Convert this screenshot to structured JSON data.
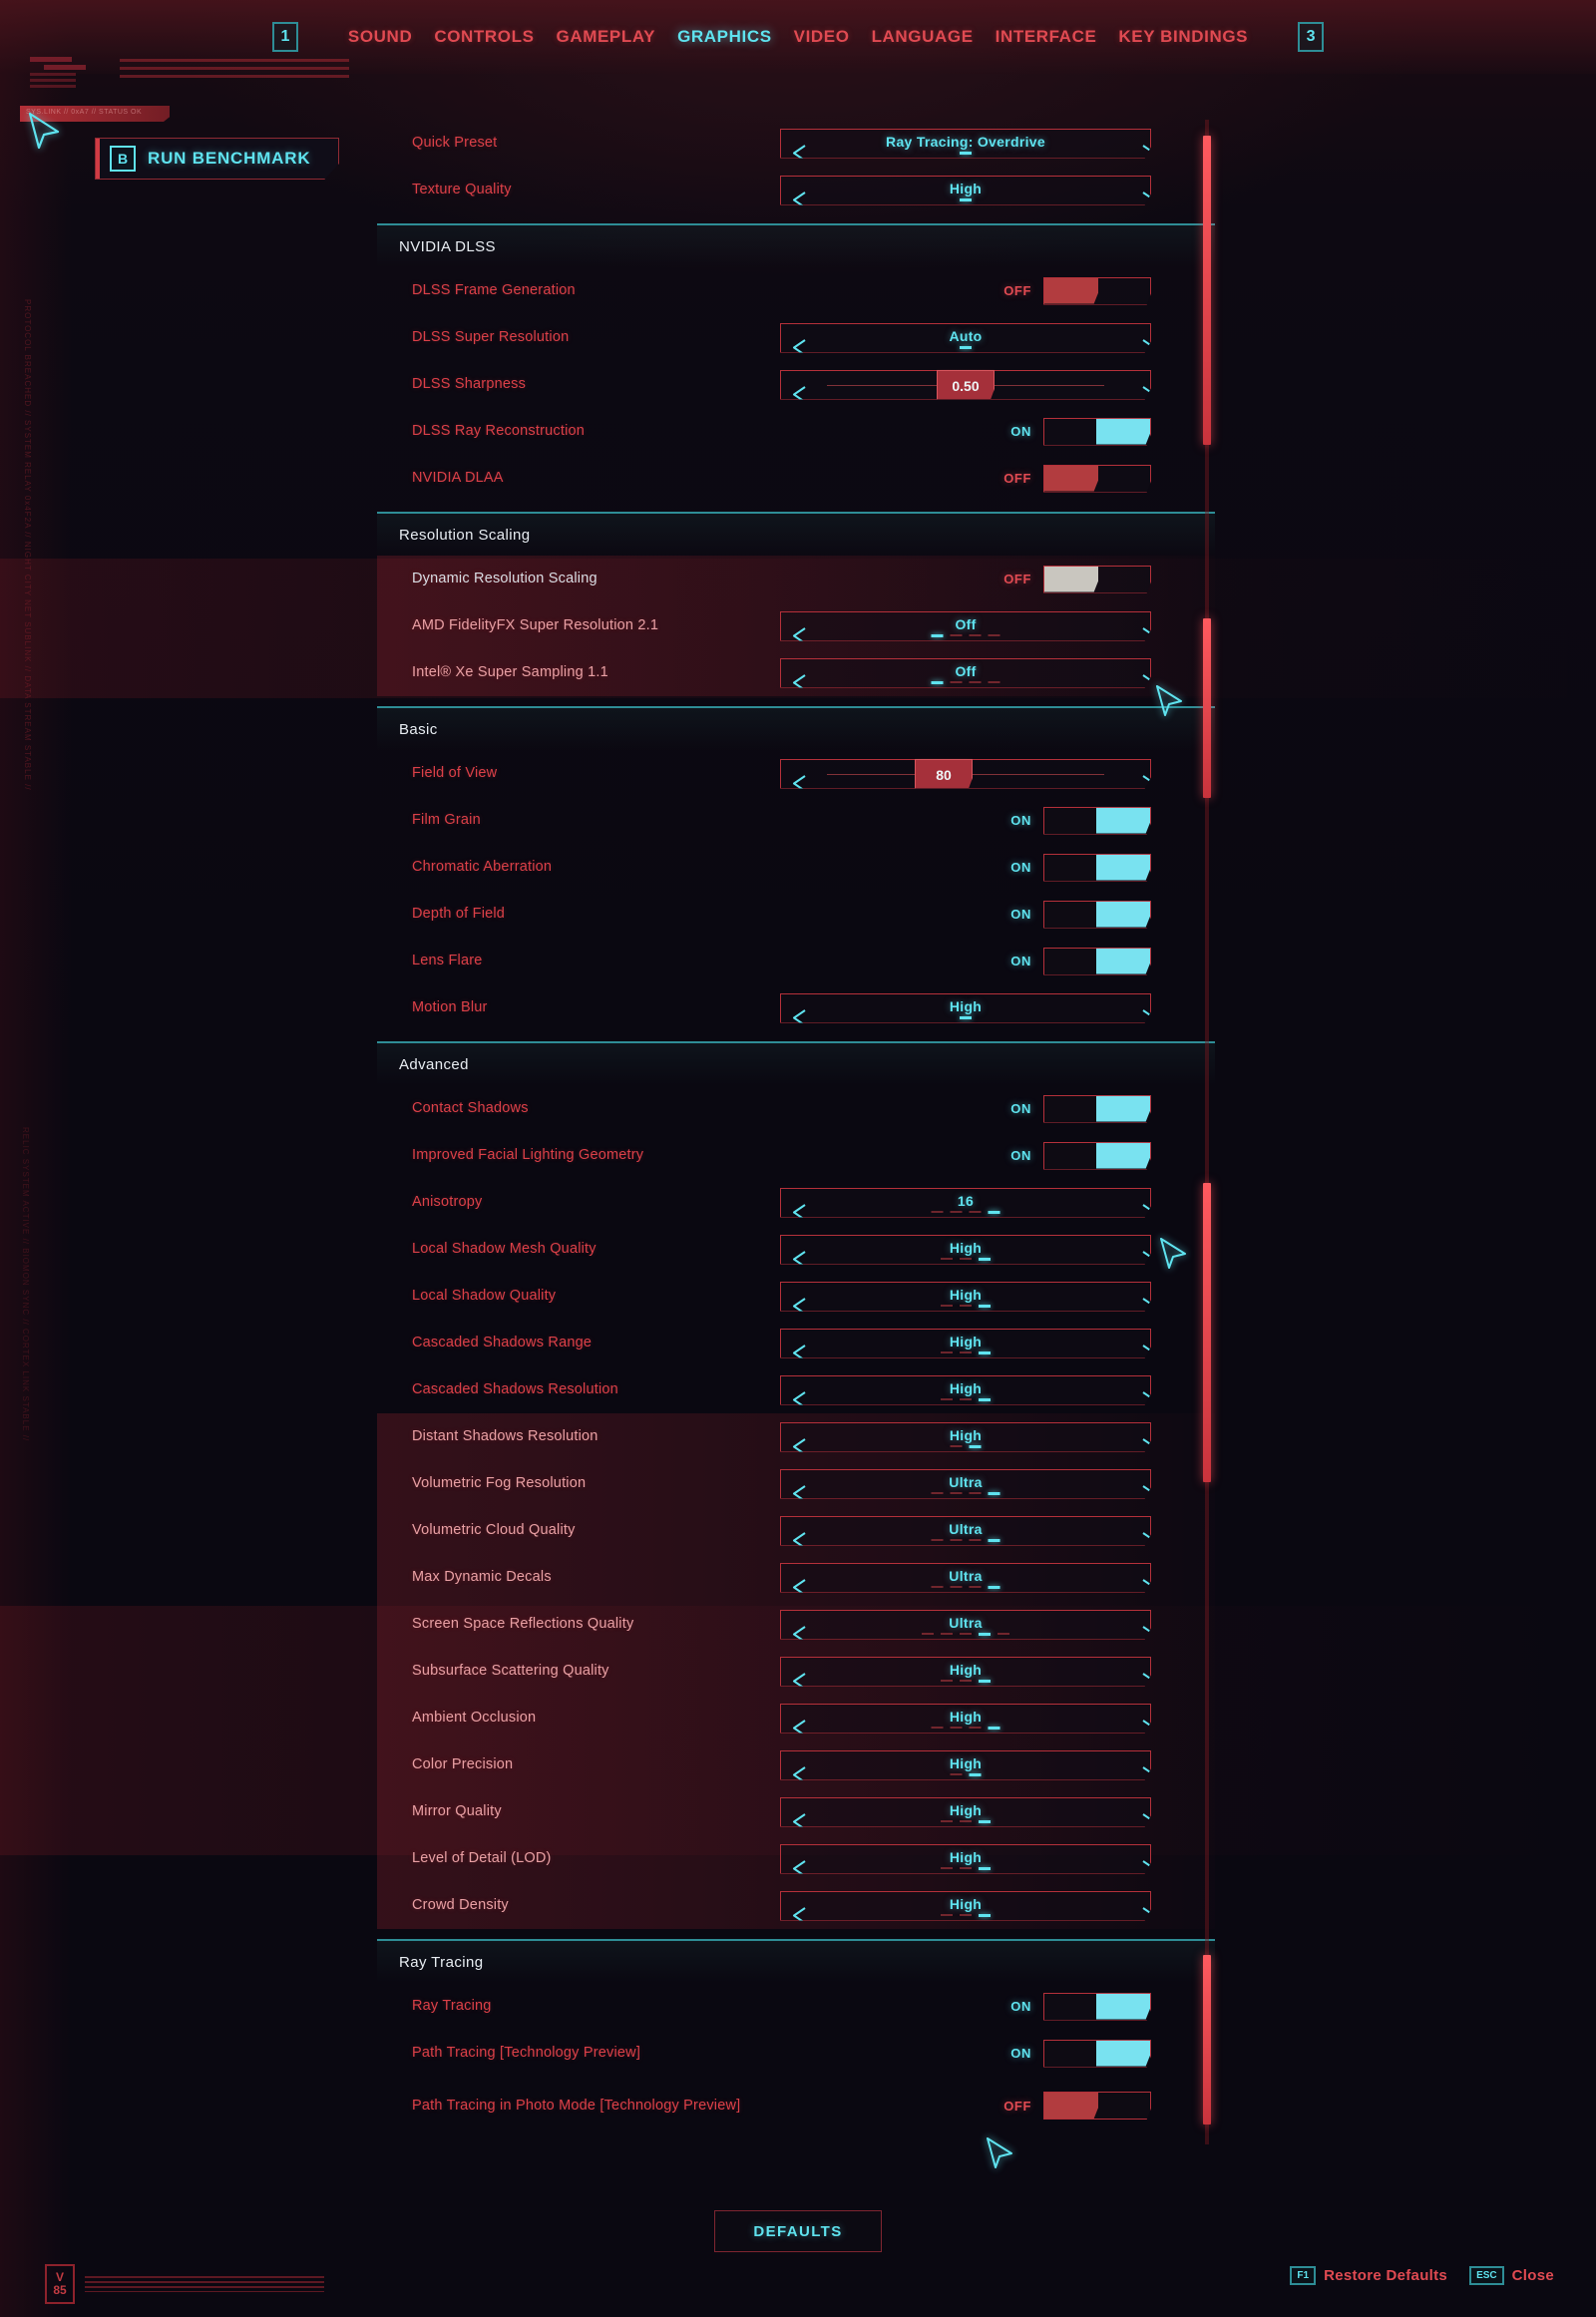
{
  "nav": {
    "left_page": "1",
    "right_page": "3",
    "items": [
      {
        "label": "SOUND",
        "active": false
      },
      {
        "label": "CONTROLS",
        "active": false
      },
      {
        "label": "GAMEPLAY",
        "active": false
      },
      {
        "label": "GRAPHICS",
        "active": true
      },
      {
        "label": "VIDEO",
        "active": false
      },
      {
        "label": "LANGUAGE",
        "active": false
      },
      {
        "label": "INTERFACE",
        "active": false
      },
      {
        "label": "KEY BINDINGS",
        "active": false
      }
    ]
  },
  "benchmark": {
    "key": "B",
    "label": "RUN BENCHMARK"
  },
  "decor": {
    "left_vertical_text": "PROTOCOL BREACHED // SYSTEM RELAY 0x4F2A // NIGHT CITY NET SUBLINK // DATA STREAM STABLE //",
    "left_vertical_text2": "RELIC SYSTEM ACTIVE // BIOMON SYNC // CORTEX LINK STABLE //",
    "red_bar_text": "SYS.LINK // 0xA7 // STATUS OK",
    "version_badge_top": "V",
    "version_badge_bottom": "85"
  },
  "settings": {
    "top_rows": [
      {
        "name": "quick-preset",
        "label": "Quick Preset",
        "type": "select",
        "value": "Ray Tracing: Overdrive",
        "tick_count": 1,
        "tick_active": 0,
        "highlight": false
      },
      {
        "name": "texture-quality",
        "label": "Texture Quality",
        "type": "select",
        "value": "High",
        "tick_count": 1,
        "tick_active": 0,
        "highlight": false
      }
    ],
    "sections": [
      {
        "title": "NVIDIA DLSS",
        "rows": [
          {
            "name": "dlss-frame-generation",
            "label": "DLSS Frame Generation",
            "type": "toggle",
            "state": "OFF",
            "highlight": false
          },
          {
            "name": "dlss-super-resolution",
            "label": "DLSS Super Resolution",
            "type": "select",
            "value": "Auto",
            "tick_count": 1,
            "tick_active": 0,
            "highlight": false
          },
          {
            "name": "dlss-sharpness",
            "label": "DLSS Sharpness",
            "type": "slider",
            "value": "0.50",
            "percent": 50,
            "highlight": false
          },
          {
            "name": "dlss-ray-reconstruction",
            "label": "DLSS Ray Reconstruction",
            "type": "toggle",
            "state": "ON",
            "highlight": false
          },
          {
            "name": "nvidia-dlaa",
            "label": "NVIDIA DLAA",
            "type": "toggle",
            "state": "OFF",
            "highlight": false
          }
        ]
      },
      {
        "title": "Resolution Scaling",
        "rows": [
          {
            "name": "dynamic-resolution-scaling",
            "label": "Dynamic Resolution Scaling",
            "type": "toggle",
            "state": "OFF",
            "highlight": true,
            "selected": true,
            "knob_grey": true
          },
          {
            "name": "amd-fidelityfx-super-resolution",
            "label": "AMD FidelityFX Super Resolution 2.1",
            "type": "select",
            "value": "Off",
            "tick_count": 4,
            "tick_active": 0,
            "highlight": true
          },
          {
            "name": "intel-xe-super-sampling",
            "label": "Intel® Xe Super Sampling 1.1",
            "type": "select",
            "value": "Off",
            "tick_count": 4,
            "tick_active": 0,
            "highlight": true
          }
        ]
      },
      {
        "title": "Basic",
        "rows": [
          {
            "name": "field-of-view",
            "label": "Field of View",
            "type": "slider",
            "value": "80",
            "percent": 40,
            "highlight": false
          },
          {
            "name": "film-grain",
            "label": "Film Grain",
            "type": "toggle",
            "state": "ON",
            "highlight": false
          },
          {
            "name": "chromatic-aberration",
            "label": "Chromatic Aberration",
            "type": "toggle",
            "state": "ON",
            "highlight": false
          },
          {
            "name": "depth-of-field",
            "label": "Depth of Field",
            "type": "toggle",
            "state": "ON",
            "highlight": false
          },
          {
            "name": "lens-flare",
            "label": "Lens Flare",
            "type": "toggle",
            "state": "ON",
            "highlight": false
          },
          {
            "name": "motion-blur",
            "label": "Motion Blur",
            "type": "select",
            "value": "High",
            "tick_count": 1,
            "tick_active": 0,
            "highlight": false
          }
        ]
      },
      {
        "title": "Advanced",
        "rows": [
          {
            "name": "contact-shadows",
            "label": "Contact Shadows",
            "type": "toggle",
            "state": "ON",
            "highlight": false
          },
          {
            "name": "improved-facial-lighting-geometry",
            "label": "Improved Facial Lighting Geometry",
            "type": "toggle",
            "state": "ON",
            "highlight": false
          },
          {
            "name": "anisotropy",
            "label": "Anisotropy",
            "type": "select",
            "value": "16",
            "tick_count": 4,
            "tick_active": 3,
            "highlight": false
          },
          {
            "name": "local-shadow-mesh-quality",
            "label": "Local Shadow Mesh Quality",
            "type": "select",
            "value": "High",
            "tick_count": 3,
            "tick_active": 2,
            "highlight": false
          },
          {
            "name": "local-shadow-quality",
            "label": "Local Shadow Quality",
            "type": "select",
            "value": "High",
            "tick_count": 3,
            "tick_active": 2,
            "highlight": false
          },
          {
            "name": "cascaded-shadows-range",
            "label": "Cascaded Shadows Range",
            "type": "select",
            "value": "High",
            "tick_count": 3,
            "tick_active": 2,
            "highlight": false
          },
          {
            "name": "cascaded-shadows-resolution",
            "label": "Cascaded Shadows Resolution",
            "type": "select",
            "value": "High",
            "tick_count": 3,
            "tick_active": 2,
            "highlight": false
          },
          {
            "name": "distant-shadows-resolution",
            "label": "Distant Shadows Resolution",
            "type": "select",
            "value": "High",
            "tick_count": 2,
            "tick_active": 1,
            "highlight": true
          },
          {
            "name": "volumetric-fog-resolution",
            "label": "Volumetric Fog Resolution",
            "type": "select",
            "value": "Ultra",
            "tick_count": 4,
            "tick_active": 3,
            "highlight": true
          },
          {
            "name": "volumetric-cloud-quality",
            "label": "Volumetric Cloud Quality",
            "type": "select",
            "value": "Ultra",
            "tick_count": 4,
            "tick_active": 3,
            "highlight": true
          },
          {
            "name": "max-dynamic-decals",
            "label": "Max Dynamic Decals",
            "type": "select",
            "value": "Ultra",
            "tick_count": 4,
            "tick_active": 3,
            "highlight": true
          },
          {
            "name": "screen-space-reflections-quality",
            "label": "Screen Space Reflections Quality",
            "type": "select",
            "value": "Ultra",
            "tick_count": 5,
            "tick_active": 3,
            "highlight": true
          },
          {
            "name": "subsurface-scattering-quality",
            "label": "Subsurface Scattering Quality",
            "type": "select",
            "value": "High",
            "tick_count": 3,
            "tick_active": 2,
            "highlight": true
          },
          {
            "name": "ambient-occlusion",
            "label": "Ambient Occlusion",
            "type": "select",
            "value": "High",
            "tick_count": 4,
            "tick_active": 3,
            "highlight": true
          },
          {
            "name": "color-precision",
            "label": "Color Precision",
            "type": "select",
            "value": "High",
            "tick_count": 2,
            "tick_active": 1,
            "highlight": true
          },
          {
            "name": "mirror-quality",
            "label": "Mirror Quality",
            "type": "select",
            "value": "High",
            "tick_count": 3,
            "tick_active": 2,
            "highlight": true
          },
          {
            "name": "level-of-detail-lod",
            "label": "Level of Detail (LOD)",
            "type": "select",
            "value": "High",
            "tick_count": 3,
            "tick_active": 2,
            "highlight": true
          },
          {
            "name": "crowd-density",
            "label": "Crowd Density",
            "type": "select",
            "value": "High",
            "tick_count": 3,
            "tick_active": 2,
            "highlight": true
          }
        ]
      },
      {
        "title": "Ray Tracing",
        "rows": [
          {
            "name": "ray-tracing",
            "label": "Ray Tracing",
            "type": "toggle",
            "state": "ON",
            "highlight": false
          },
          {
            "name": "path-tracing-technology-preview",
            "label": "Path Tracing [Technology Preview]",
            "type": "toggle",
            "state": "ON",
            "highlight": false
          },
          {
            "name": "path-tracing-photo-mode",
            "label": "Path Tracing in Photo Mode [Technology Preview]",
            "type": "toggle",
            "state": "OFF",
            "highlight": false,
            "tall": true
          }
        ]
      }
    ]
  },
  "footer": {
    "defaults_label": "DEFAULTS",
    "hints": [
      {
        "key": "F1",
        "label": "Restore Defaults"
      },
      {
        "key": "ESC",
        "label": "Close"
      }
    ]
  },
  "colors": {
    "accent_red": "#e03e3e",
    "accent_cyan": "#5fe3ef",
    "background": "#0a0811"
  }
}
